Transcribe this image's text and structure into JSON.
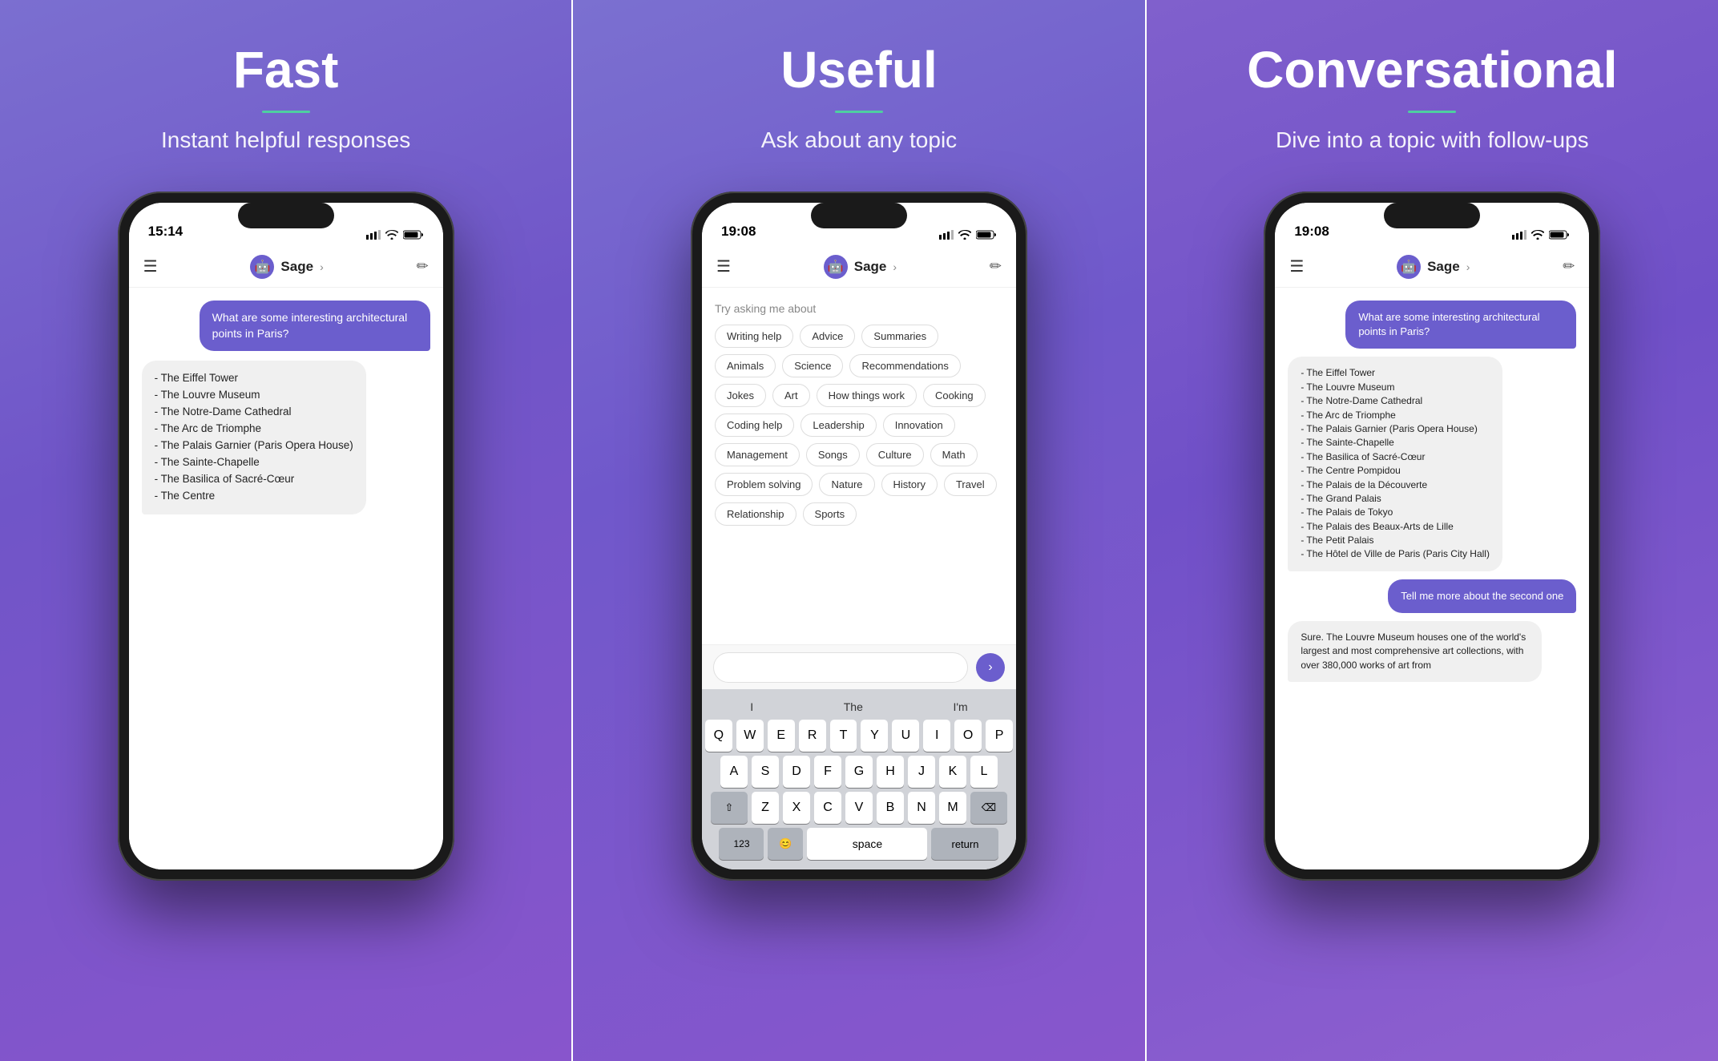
{
  "panels": [
    {
      "id": "fast",
      "title": "Fast",
      "subtitle": "Instant helpful responses",
      "phone": {
        "time": "15:14",
        "header_name": "Sage",
        "user_bubble": "What are some interesting architectural points in Paris?",
        "ai_response": "- The Eiffel Tower\n- The Louvre Museum\n- The Notre-Dame Cathedral\n- The Arc de Triomphe\n- The Palais Garnier (Paris Opera House)\n- The Sainte-Chapelle\n- The Basilica of Sacré-Cœur\n- The Centre"
      }
    },
    {
      "id": "useful",
      "title": "Useful",
      "subtitle": "Ask about any topic",
      "phone": {
        "time": "19:08",
        "header_name": "Sage",
        "topics_label": "Try asking me about",
        "topics": [
          "Writing help",
          "Advice",
          "Summaries",
          "Animals",
          "Science",
          "Recommendations",
          "Jokes",
          "Art",
          "How things work",
          "Cooking",
          "Coding help",
          "Leadership",
          "Innovation",
          "Management",
          "Songs",
          "Culture",
          "Math",
          "Problem solving",
          "Nature",
          "History",
          "Travel",
          "Relationship",
          "Sports"
        ]
      }
    },
    {
      "id": "conversational",
      "title": "Conversational",
      "subtitle": "Dive into a topic with follow-ups",
      "phone": {
        "time": "19:08",
        "header_name": "Sage",
        "user_bubble": "What are some interesting architectural points in Paris?",
        "ai_response_1": "- The Eiffel Tower\n- The Louvre Museum\n- The Notre-Dame Cathedral\n- The Arc de Triomphe\n- The Palais Garnier (Paris Opera House)\n- The Sainte-Chapelle\n- The Basilica of Sacré-Cœur\n- The Centre Pompidou\n- The Palais de la Découverte\n- The Grand Palais\n- The Palais de Tokyo\n- The Palais des Beaux-Arts de Lille\n- The Petit Palais\n- The Hôtel de Ville de Paris (Paris City Hall)",
        "user_bubble_2": "Tell me more about the second one",
        "ai_response_2": "Sure. The Louvre Museum houses one of the world's largest and most comprehensive art collections, with over 380,000 works of art from"
      }
    }
  ],
  "keyboard": {
    "suggestions": [
      "I",
      "The",
      "I'm"
    ],
    "rows": [
      [
        "Q",
        "W",
        "E",
        "R",
        "T",
        "Y",
        "U",
        "I",
        "O",
        "P"
      ],
      [
        "A",
        "S",
        "D",
        "F",
        "G",
        "H",
        "J",
        "K",
        "L"
      ],
      [
        "⇧",
        "Z",
        "X",
        "C",
        "V",
        "B",
        "N",
        "M",
        "⌫"
      ],
      [
        "123",
        "😊",
        "space",
        "return"
      ]
    ]
  }
}
